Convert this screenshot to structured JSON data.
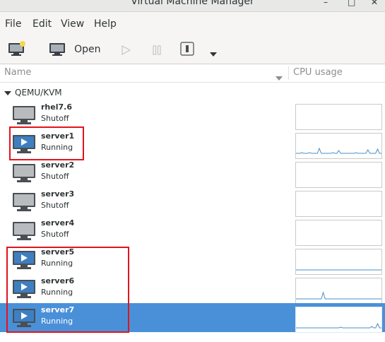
{
  "window": {
    "title": "Virtual Machine Manager"
  },
  "menu": [
    "File",
    "Edit",
    "View",
    "Help"
  ],
  "toolbar": {
    "open_label": "Open"
  },
  "columns": {
    "name": "Name",
    "cpu": "CPU usage"
  },
  "group": {
    "label": "QEMU/KVM"
  },
  "vms": [
    {
      "name": "rhel7.6",
      "status": "Shutoff",
      "running": false
    },
    {
      "name": "server1",
      "status": "Running",
      "running": true
    },
    {
      "name": "server2",
      "status": "Shutoff",
      "running": false
    },
    {
      "name": "server3",
      "status": "Shutoff",
      "running": false
    },
    {
      "name": "server4",
      "status": "Shutoff",
      "running": false
    },
    {
      "name": "server5",
      "status": "Running",
      "running": true
    },
    {
      "name": "server6",
      "status": "Running",
      "running": true
    },
    {
      "name": "server7",
      "status": "Running",
      "running": true,
      "selected": true
    }
  ],
  "colors": {
    "selection": "#4a90d9",
    "highlight_box": "#e2141c",
    "graph_line": "#4a8fc8"
  }
}
